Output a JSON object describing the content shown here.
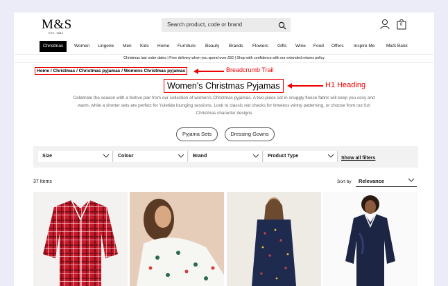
{
  "brand": {
    "logo": "M&S",
    "sub": "EST. 1884"
  },
  "search": {
    "placeholder": "Search product, code or brand"
  },
  "header": {
    "bag_count": "0"
  },
  "nav": [
    "Christmas",
    "Women",
    "Lingerie",
    "Men",
    "Kids",
    "Home",
    "Furniture",
    "Beauty",
    "Brands",
    "Flowers",
    "Gifts",
    "Wine",
    "Food",
    "Offers",
    "Inspire Me",
    "M&S Bank"
  ],
  "promo": "Christmas last order dates   |   Free delivery when you spend over £50   |   Shop with confidence with our extended returns policy",
  "breadcrumb": "Home / Christmas / Christmas pyjamas / Womens Christmas pyjamas",
  "annotations": {
    "breadcrumb": "Breadcrumb Trail",
    "h1": "H1 Heading"
  },
  "page_title": "Women's Christmas Pyjamas",
  "description": "Celebrate the season with a festive pair from our collection of women's Christmas pyjamas. A two-piece set in snuggly fleece fabric will keep you cosy and warm, while a shorter sets are perfect for Yuletide lounging sessions. Look to classic red checks for timeless wintry patterning, or choose from our fun Christmas character designs",
  "pills": [
    "Pyjama Sets",
    "Dressing Gowns"
  ],
  "filters": [
    "Size",
    "Colour",
    "Brand",
    "Product Type"
  ],
  "show_all": "Show all filters",
  "items_count": "37 Items",
  "sort": {
    "label": "Sort by",
    "value": "Relevance"
  }
}
